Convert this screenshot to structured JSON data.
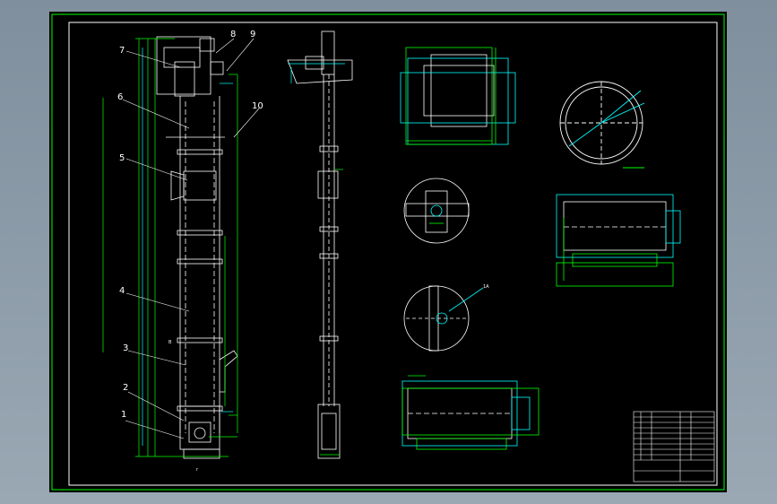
{
  "drawing": {
    "background": "#000000",
    "colors": {
      "border": "#00ff00",
      "white": "#ffffff",
      "cyan": "#00ffff",
      "green": "#00ff00"
    },
    "callouts": [
      {
        "n": "1"
      },
      {
        "n": "2"
      },
      {
        "n": "3"
      },
      {
        "n": "4"
      },
      {
        "n": "5"
      },
      {
        "n": "6"
      },
      {
        "n": "7"
      },
      {
        "n": "8"
      },
      {
        "n": "9"
      },
      {
        "n": "10"
      }
    ],
    "bottom_mark": "r",
    "side_mark": "B",
    "detail_tag": "1A"
  }
}
